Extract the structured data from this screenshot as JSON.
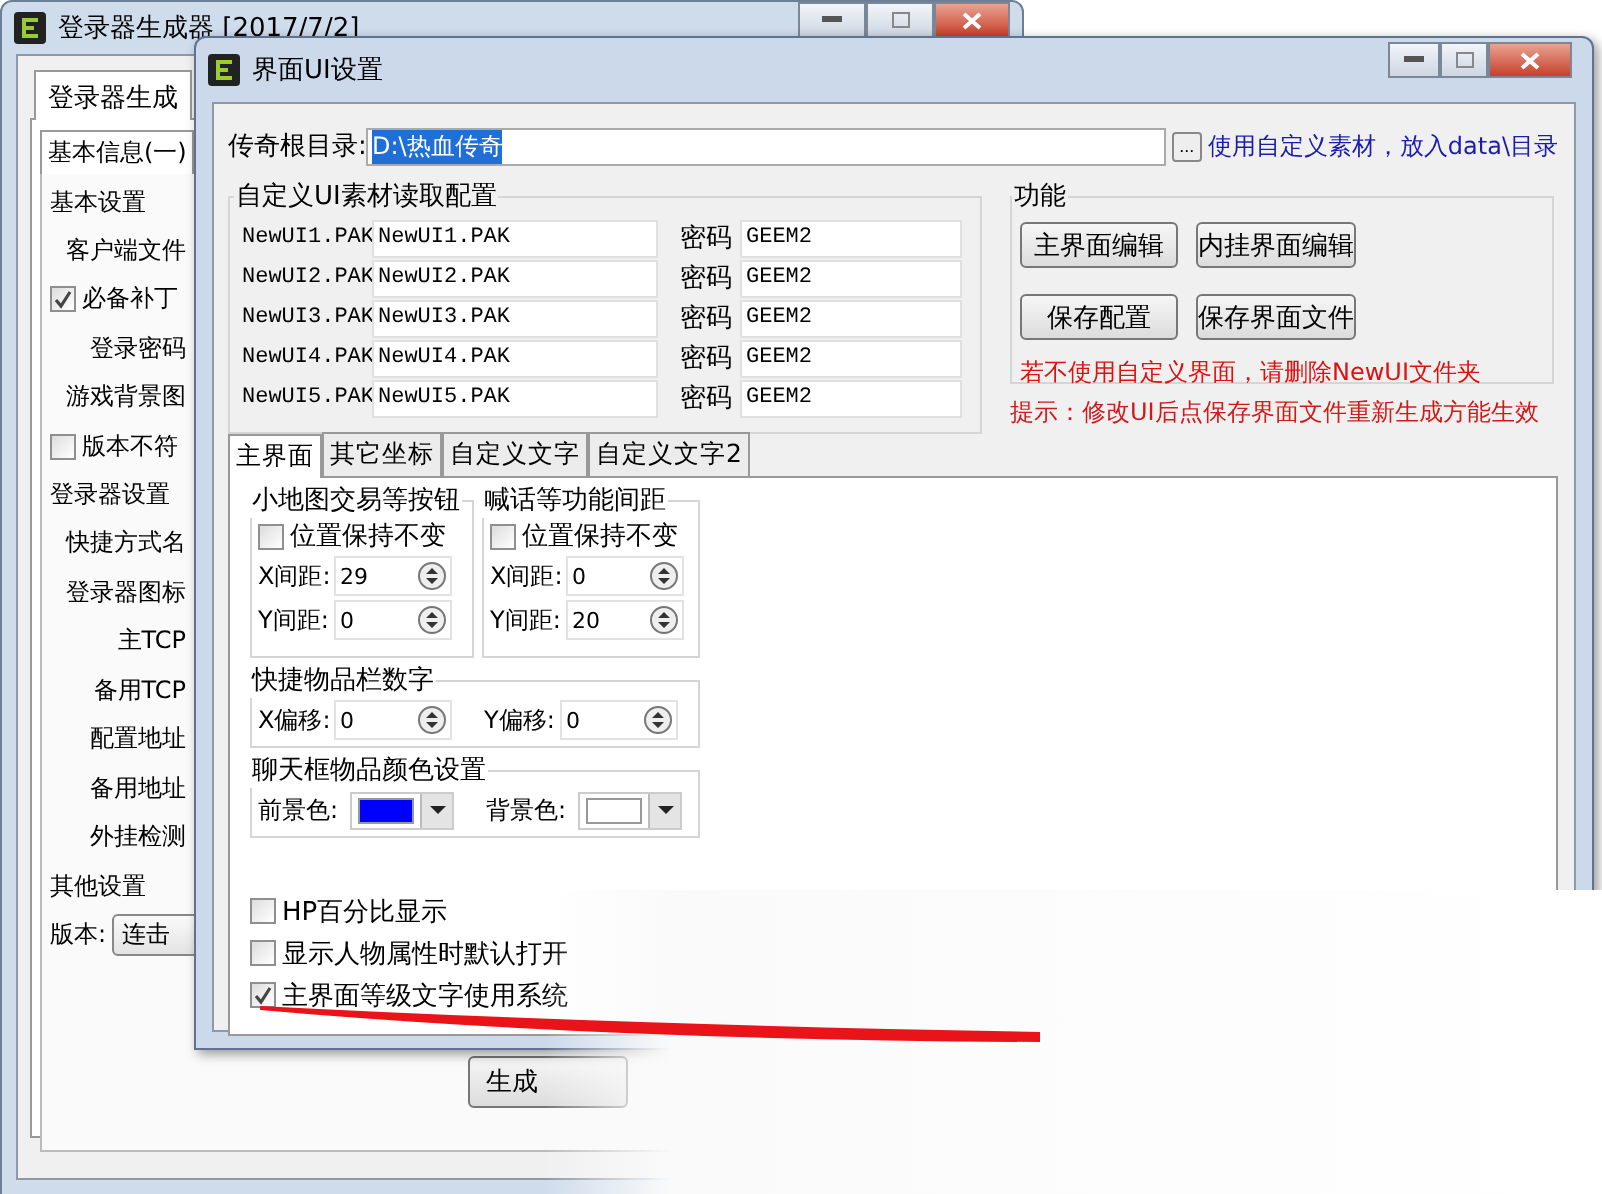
{
  "back_window": {
    "title": "登录器生成器 [2017/7/2]",
    "tabs": [
      {
        "label": "登录器生成",
        "selected": true
      }
    ],
    "sub_tabs": [
      {
        "label": "基本信息(一)",
        "selected": true
      }
    ],
    "items": [
      {
        "kind": "heading",
        "text": "基本设置"
      },
      {
        "kind": "label",
        "text": "客户端文件"
      },
      {
        "kind": "checkbox",
        "text": "必备补丁",
        "checked": true
      },
      {
        "kind": "label",
        "text": "登录密码"
      },
      {
        "kind": "label",
        "text": "游戏背景图"
      },
      {
        "kind": "checkbox",
        "text": "版本不符",
        "checked": false
      },
      {
        "kind": "heading",
        "text": "登录器设置"
      },
      {
        "kind": "label",
        "text": "快捷方式名"
      },
      {
        "kind": "label",
        "text": "登录器图标"
      },
      {
        "kind": "label",
        "text": "主TCP"
      },
      {
        "kind": "label",
        "text": "备用TCP"
      },
      {
        "kind": "label",
        "text": "配置地址"
      },
      {
        "kind": "label",
        "text": "备用地址"
      },
      {
        "kind": "label",
        "text": "外挂检测"
      },
      {
        "kind": "heading",
        "text": "其他设置"
      },
      {
        "kind": "combo",
        "text": "版本:",
        "value": "连击"
      }
    ],
    "generate_button": "生成"
  },
  "dialog": {
    "title": "界面UI设置",
    "root_dir": {
      "label": "传奇根目录:",
      "value": "D:\\热血传奇",
      "browse_button": "...",
      "note": "使用自定义素材，放入data\\目录"
    },
    "ui_files": {
      "title": "自定义UI素材读取配置",
      "rows": [
        {
          "name": "NewUI1.PAK",
          "file": "NewUI1.PAK",
          "password_label": "密码",
          "password": "GEEM2"
        },
        {
          "name": "NewUI2.PAK",
          "file": "NewUI2.PAK",
          "password_label": "密码",
          "password": "GEEM2"
        },
        {
          "name": "NewUI3.PAK",
          "file": "NewUI3.PAK",
          "password_label": "密码",
          "password": "GEEM2"
        },
        {
          "name": "NewUI4.PAK",
          "file": "NewUI4.PAK",
          "password_label": "密码",
          "password": "GEEM2"
        },
        {
          "name": "NewUI5.PAK",
          "file": "NewUI5.PAK",
          "password_label": "密码",
          "password": "GEEM2"
        }
      ]
    },
    "functions": {
      "title": "功能",
      "buttons": [
        "主界面编辑",
        "内挂界面编辑",
        "保存配置",
        "保存界面文件"
      ],
      "warning": "若不使用自定义界面，请删除NewUI文件夹"
    },
    "hint": "提示：修改UI后点保存界面文件重新生成方能生效",
    "tabs": [
      {
        "label": "主界面",
        "selected": true
      },
      {
        "label": "其它坐标",
        "selected": false
      },
      {
        "label": "自定义文字",
        "selected": false
      },
      {
        "label": "自定义文字2",
        "selected": false
      }
    ],
    "spacing_groups": [
      {
        "title": "小地图交易等按钮",
        "checkbox": {
          "label": "位置保持不变",
          "checked": false
        },
        "fields": [
          {
            "label": "X间距:",
            "value": "29"
          },
          {
            "label": "Y间距:",
            "value": "0"
          }
        ]
      },
      {
        "title": "喊话等功能间距",
        "checkbox": {
          "label": "位置保持不变",
          "checked": false
        },
        "fields": [
          {
            "label": "X间距:",
            "value": "0"
          },
          {
            "label": "Y间距:",
            "value": "20"
          }
        ]
      }
    ],
    "offset_group": {
      "title": "快捷物品栏数字",
      "fields": [
        {
          "label": "X偏移:",
          "value": "0"
        },
        {
          "label": "Y偏移:",
          "value": "0"
        }
      ]
    },
    "color_group": {
      "title": "聊天框物品颜色设置",
      "pickers": [
        {
          "label": "前景色:",
          "color": "#0000ff"
        },
        {
          "label": "背景色:",
          "color": "#ffffff"
        }
      ]
    },
    "options": [
      {
        "label": "HP百分比显示",
        "checked": false
      },
      {
        "label": "显示人物属性时默认打开",
        "checked": false
      },
      {
        "label": "主界面等级文字使用系统",
        "checked": true
      }
    ]
  }
}
